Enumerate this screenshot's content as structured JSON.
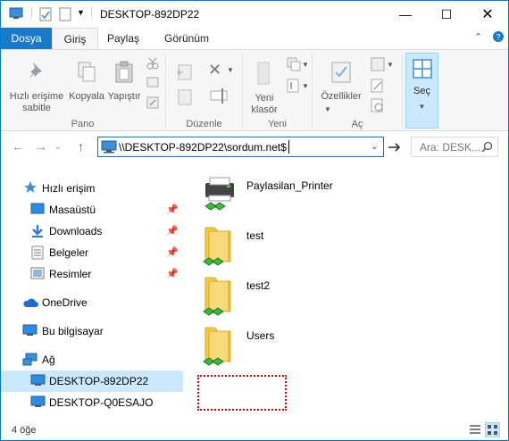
{
  "window": {
    "title": "DESKTOP-892DP22",
    "accent": "#0078d7"
  },
  "menu": {
    "tabs": [
      "Dosya",
      "Giriş",
      "Paylaş",
      "Görünüm"
    ],
    "active": "Giriş"
  },
  "ribbon": {
    "pin_label": "Hızlı erişime sabitle",
    "copy_label": "Kopyala",
    "paste_label": "Yapıştır",
    "group_pano": "Pano",
    "group_duzenle": "Düzenle",
    "new_folder_label": "Yeni klasör",
    "group_yeni": "Yeni",
    "properties_label": "Özellikler",
    "group_ac": "Aç",
    "select_label": "Seç"
  },
  "address": {
    "path": "\\\\DESKTOP-892DP22\\sordum.net$",
    "search_placeholder": "Ara: DESK..."
  },
  "nav": {
    "quick_access": "Hızlı erişim",
    "desktop": "Masaüstü",
    "downloads": "Downloads",
    "documents": "Belgeler",
    "pictures": "Resimler",
    "onedrive": "OneDrive",
    "this_pc": "Bu bilgisayar",
    "network": "Ağ",
    "host1": "DESKTOP-892DP22",
    "host2": "DESKTOP-Q0ESAJO"
  },
  "files": [
    {
      "name": "Paylasilan_Printer",
      "type": "printer"
    },
    {
      "name": "test",
      "type": "shared-folder"
    },
    {
      "name": "test2",
      "type": "shared-folder"
    },
    {
      "name": "Users",
      "type": "shared-folder"
    }
  ],
  "status": {
    "count": "4 öğe"
  }
}
